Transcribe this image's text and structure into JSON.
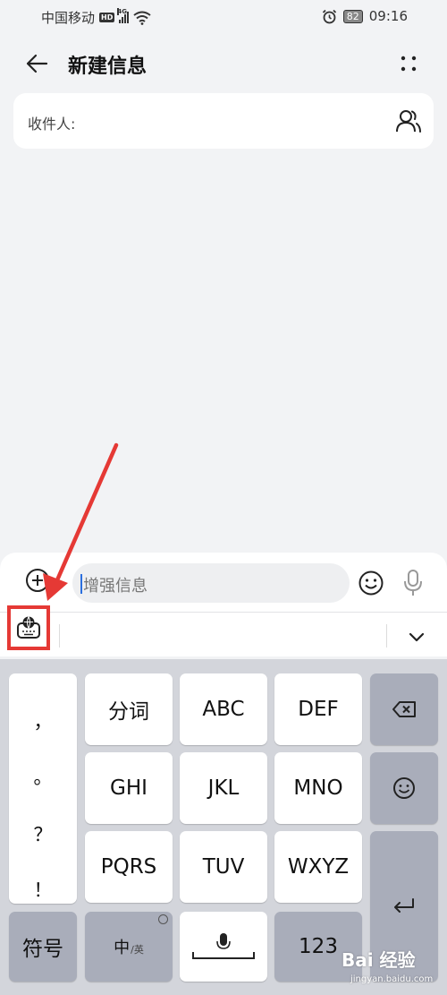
{
  "status_bar": {
    "carrier": "中国移动",
    "hd": "HD",
    "network": "4G",
    "battery": "82",
    "time": "09:16"
  },
  "header": {
    "title": "新建信息",
    "back_icon": "back-arrow-icon",
    "more_icon": "more-dots-icon"
  },
  "recipient": {
    "label": "收件人:",
    "icon": "contacts-icon"
  },
  "compose": {
    "input_placeholder": "增强信息",
    "add_icon": "add-circle-icon",
    "emoji_icon": "emoji-icon",
    "mic_icon": "mic-icon",
    "input_method_icon": "keyboard-globe-icon",
    "collapse_icon": "chevron-down-icon"
  },
  "keyboard": {
    "punctuation": [
      "，",
      "。",
      "？",
      "！"
    ],
    "row1": [
      "分词",
      "ABC",
      "DEF"
    ],
    "row2": [
      "GHI",
      "JKL",
      "MNO"
    ],
    "row3": [
      "PQRS",
      "TUV",
      "WXYZ"
    ],
    "symbols": "符号",
    "lang_main": "中",
    "lang_alt": "/英",
    "numbers": "123",
    "delete_icon": "backspace-icon",
    "emoji_icon": "emoji-icon",
    "enter_icon": "enter-icon",
    "space_icon": "space-mic-icon"
  },
  "annotation": {
    "color": "#e53935"
  },
  "watermark": {
    "brand": "Bai 经验",
    "sub": "jingyan.baidu.com"
  }
}
